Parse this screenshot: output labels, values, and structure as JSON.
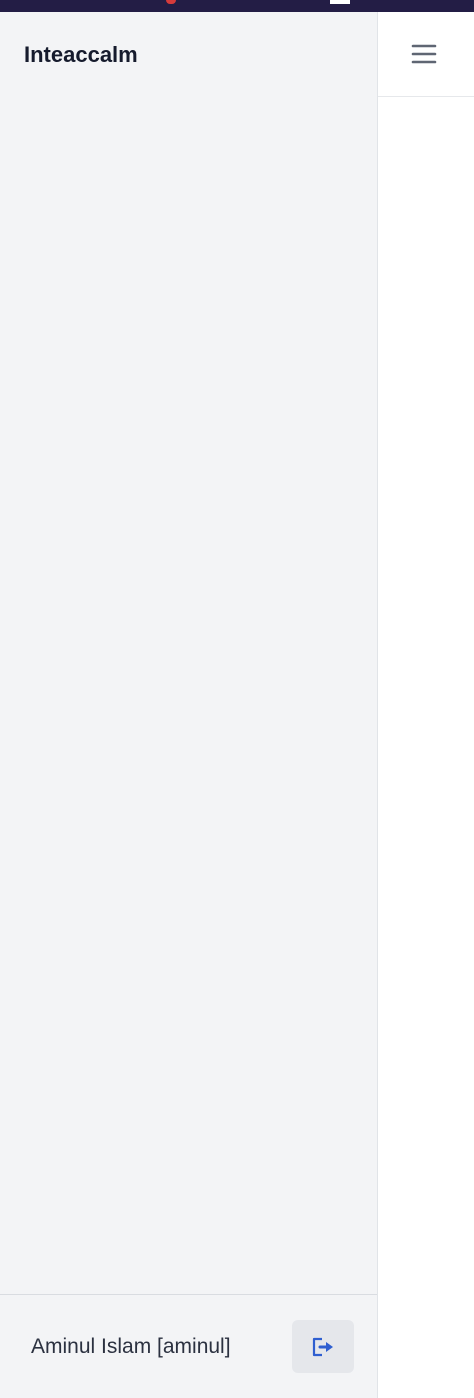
{
  "app": {
    "title": "Inteaccalm"
  },
  "sidebar": {
    "footer": {
      "user_label": "Aminul Islam [aminul]",
      "logout_icon": "logout-icon"
    }
  },
  "header": {
    "menu_icon": "hamburger-icon"
  },
  "colors": {
    "top_strip": "#231d45",
    "sidebar_bg": "#f3f4f6",
    "logout_icon": "#2f5fd0",
    "menu_icon": "#5f6673"
  }
}
